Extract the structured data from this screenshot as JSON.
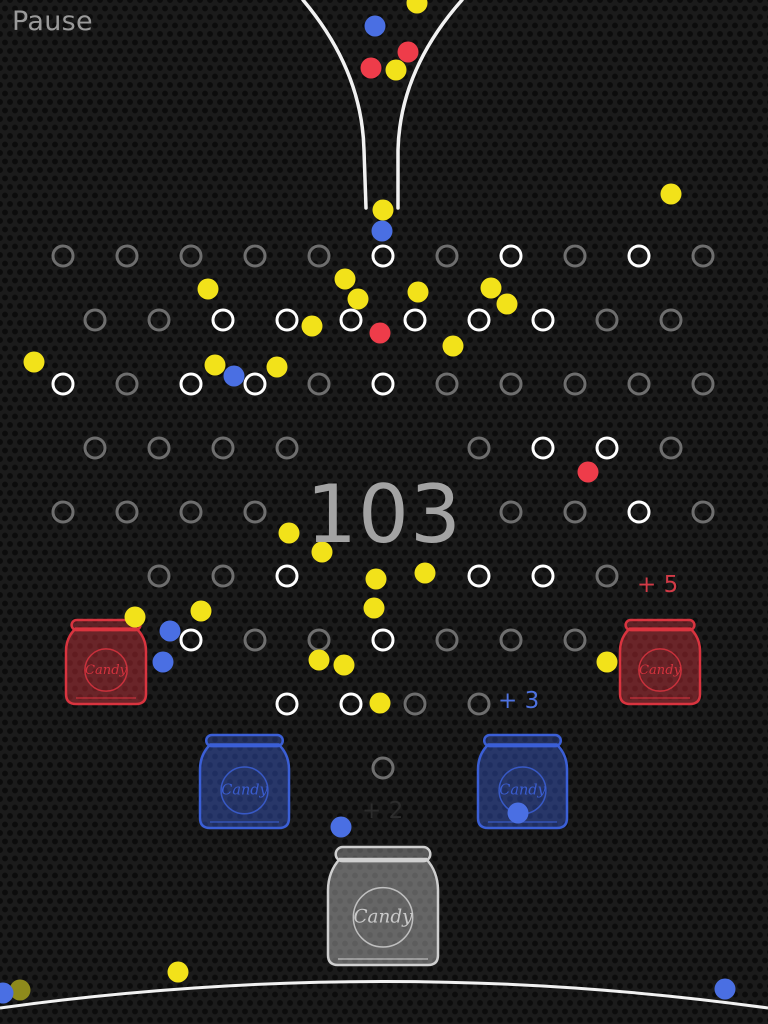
{
  "hud": {
    "pause_label": "Pause",
    "score": "103"
  },
  "jars": [
    {
      "name": "jar-red-left",
      "color": "#d9343f",
      "label": "Candy",
      "bonus": ""
    },
    {
      "name": "jar-red-right",
      "color": "#d9343f",
      "label": "Candy",
      "bonus": "+ 5"
    },
    {
      "name": "jar-blue-left",
      "color": "#3b5fd6",
      "label": "Candy",
      "bonus": ""
    },
    {
      "name": "jar-blue-right",
      "color": "#3b5fd6",
      "label": "Candy",
      "bonus": "+ 3"
    },
    {
      "name": "jar-gray-center",
      "color": "#cfcfcf",
      "label": "Candy",
      "bonus": "+ 2"
    }
  ],
  "ball_colors": {
    "yellow": "#f2e21a",
    "blue": "#4a6fe3",
    "red": "#ee3c4a",
    "olive": "#8e8a1c"
  },
  "peg_colors": {
    "active": "#ffffff",
    "inactive": "#6e6e6e"
  }
}
